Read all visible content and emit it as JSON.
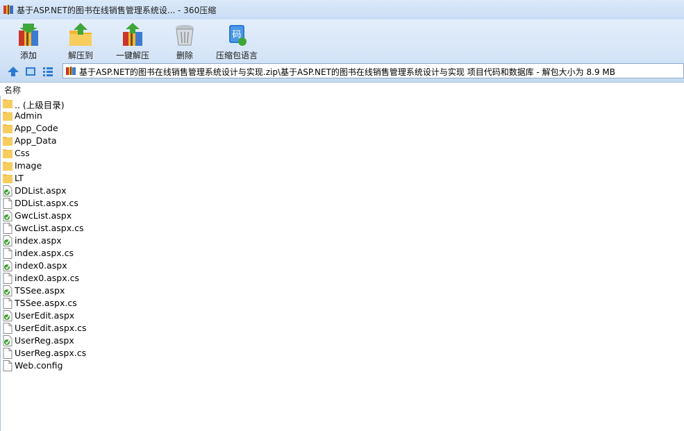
{
  "window": {
    "title": "基于ASP.NET的图书在线销售管理系统设... - 360压缩"
  },
  "toolbar": {
    "items": [
      {
        "label": "添加",
        "icon": "add-archive-icon"
      },
      {
        "label": "解压到",
        "icon": "extract-to-icon"
      },
      {
        "label": "一键解压",
        "icon": "one-click-extract-icon"
      },
      {
        "label": "删除",
        "icon": "delete-icon"
      },
      {
        "label": "压缩包语言",
        "icon": "archive-language-icon",
        "icon_text": "码"
      }
    ]
  },
  "nav": {
    "up_icon": "up-arrow-icon",
    "view_icon": "thumbnail-view-icon",
    "list_icon": "list-view-icon"
  },
  "address": {
    "path": "基于ASP.NET的图书在线销售管理系统设计与实现.zip\\基于ASP.NET的图书在线销售管理系统设计与实现 项目代码和数据库 - 解包大小为 8.9 MB"
  },
  "columns": {
    "name": "名称"
  },
  "files": [
    {
      "name": ".. (上级目录)",
      "type": "folder"
    },
    {
      "name": "Admin",
      "type": "folder"
    },
    {
      "name": "App_Code",
      "type": "folder"
    },
    {
      "name": "App_Data",
      "type": "folder"
    },
    {
      "name": "Css",
      "type": "folder"
    },
    {
      "name": "Image",
      "type": "folder"
    },
    {
      "name": "LT",
      "type": "folder"
    },
    {
      "name": "DDList.aspx",
      "type": "aspx"
    },
    {
      "name": "DDList.aspx.cs",
      "type": "file"
    },
    {
      "name": "GwcList.aspx",
      "type": "aspx"
    },
    {
      "name": "GwcList.aspx.cs",
      "type": "file"
    },
    {
      "name": "index.aspx",
      "type": "aspx"
    },
    {
      "name": "index.aspx.cs",
      "type": "file"
    },
    {
      "name": "index0.aspx",
      "type": "aspx"
    },
    {
      "name": "index0.aspx.cs",
      "type": "file"
    },
    {
      "name": "TSSee.aspx",
      "type": "aspx"
    },
    {
      "name": "TSSee.aspx.cs",
      "type": "file"
    },
    {
      "name": "UserEdit.aspx",
      "type": "aspx"
    },
    {
      "name": "UserEdit.aspx.cs",
      "type": "file"
    },
    {
      "name": "UserReg.aspx",
      "type": "aspx"
    },
    {
      "name": "UserReg.aspx.cs",
      "type": "file"
    },
    {
      "name": "Web.config",
      "type": "file"
    }
  ],
  "colors": {
    "folder": "#f7cd5e",
    "accent": "#2a7bd4",
    "aspx_badge": "#3a9d2f"
  }
}
